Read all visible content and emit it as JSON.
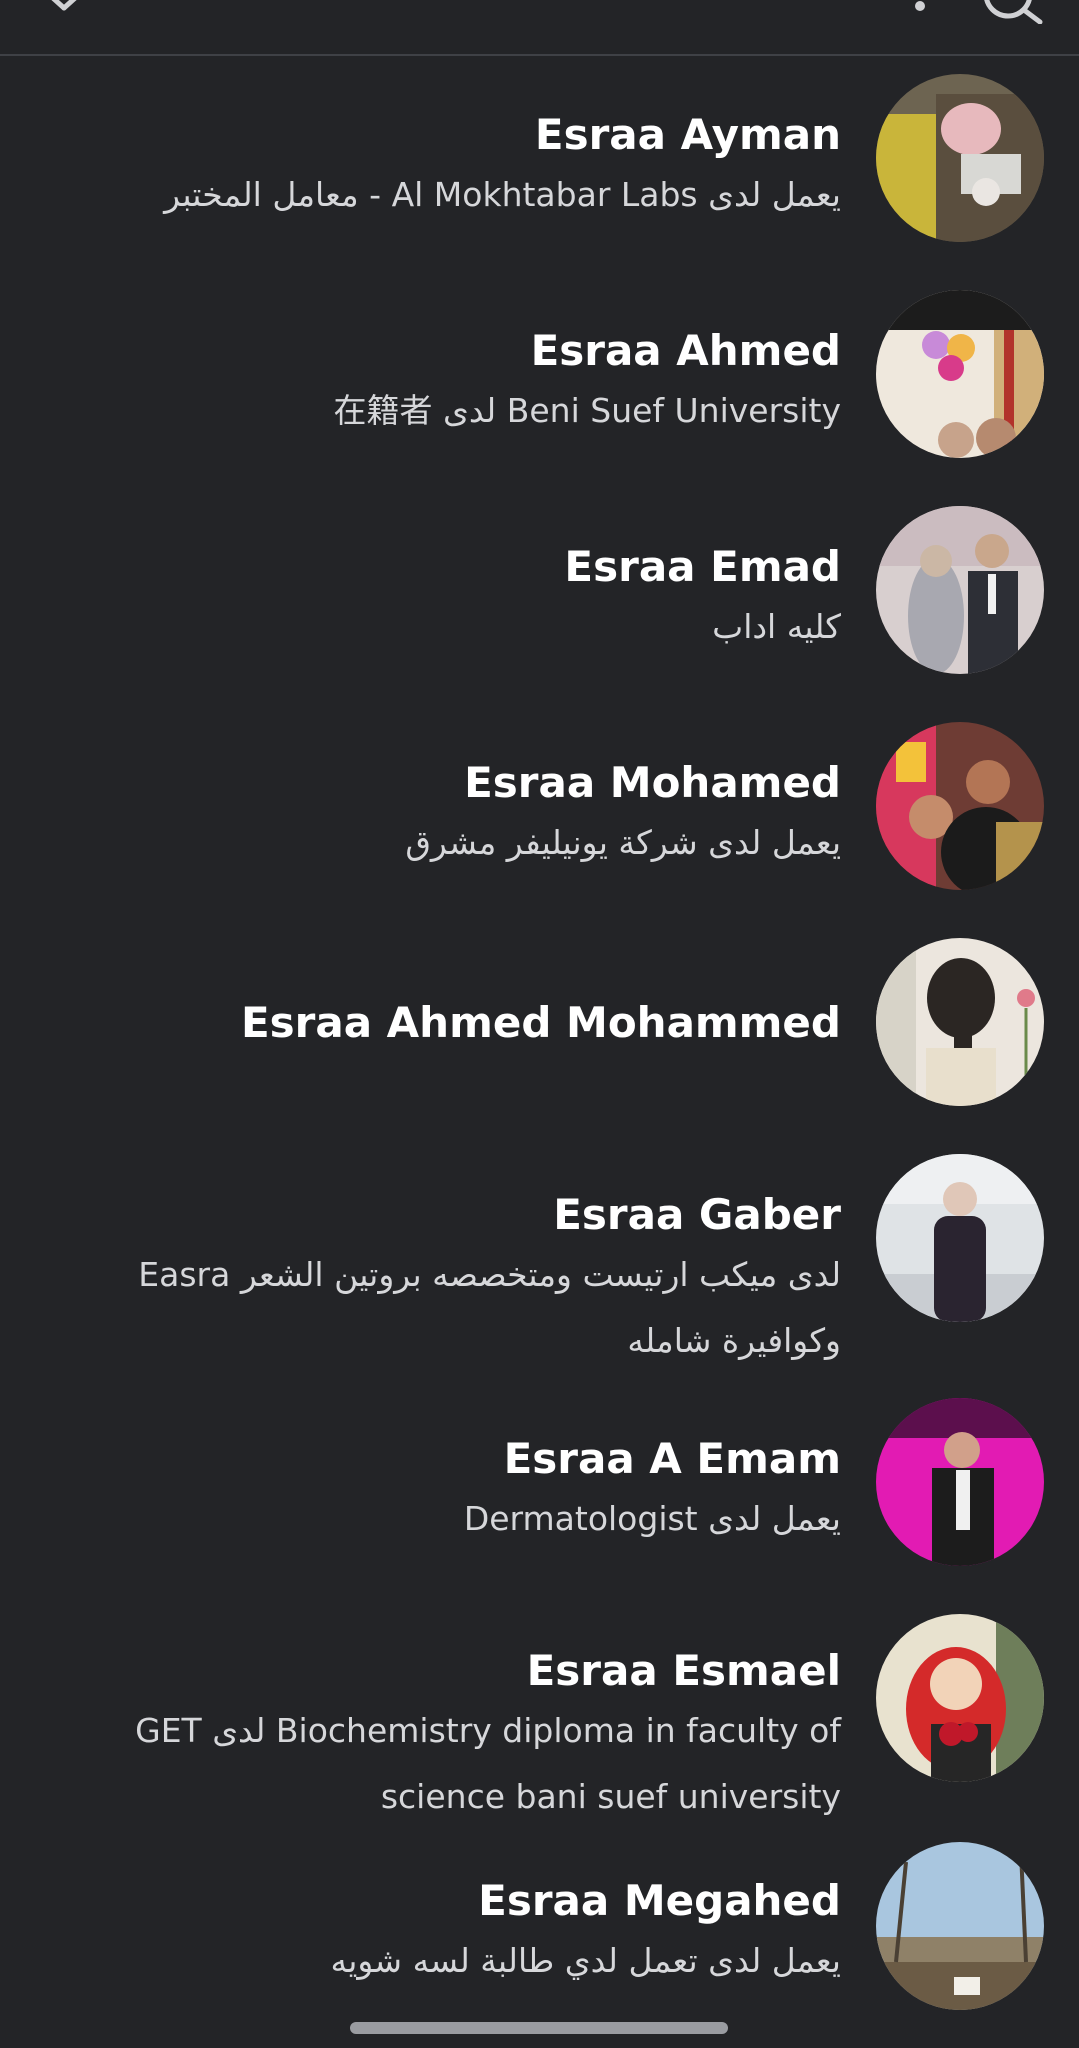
{
  "people": [
    {
      "name": "Esraa Ayman",
      "subtitle": "يعمل لدى Al Mokhtabar Labs - معامل المختبر",
      "avatar_icon": "person-photo-avatar"
    },
    {
      "name": "Esraa Ahmed",
      "subtitle": "在籍者 لدى Beni Suef University",
      "avatar_icon": "person-photo-avatar"
    },
    {
      "name": "Esraa Emad",
      "subtitle": "كليه اداب",
      "avatar_icon": "person-photo-avatar"
    },
    {
      "name": "Esraa Mohamed",
      "subtitle": "يعمل لدى شركة يونيليفر مشرق",
      "avatar_icon": "person-photo-avatar"
    },
    {
      "name": "Esraa Ahmed Mohammed",
      "subtitle": "",
      "avatar_icon": "person-photo-avatar"
    },
    {
      "name": "Esraa Gaber",
      "subtitle": "Easra لدى ميكب ارتيست ومتخصصه بروتين الشعر وكوافيرة شامله",
      "avatar_icon": "person-photo-avatar"
    },
    {
      "name": "Esraa A Emam",
      "subtitle": "يعمل لدى Dermatologist",
      "avatar_icon": "person-photo-avatar"
    },
    {
      "name": "Esraa Esmael",
      "subtitle": "GET لدى Biochemistry diploma in faculty of science bani suef university",
      "avatar_icon": "person-photo-avatar"
    },
    {
      "name": "Esraa Megahed",
      "subtitle": "يعمل لدى تعمل لدي طالبة لسه شويه",
      "avatar_icon": "person-photo-avatar"
    }
  ],
  "icons": {
    "close": "close-icon",
    "search": "search-icon",
    "more": "more-icon"
  },
  "colors": {
    "background": "#232427",
    "name_text": "#ffffff",
    "subtitle_text": "#d6d7da",
    "divider": "#3f4146"
  }
}
